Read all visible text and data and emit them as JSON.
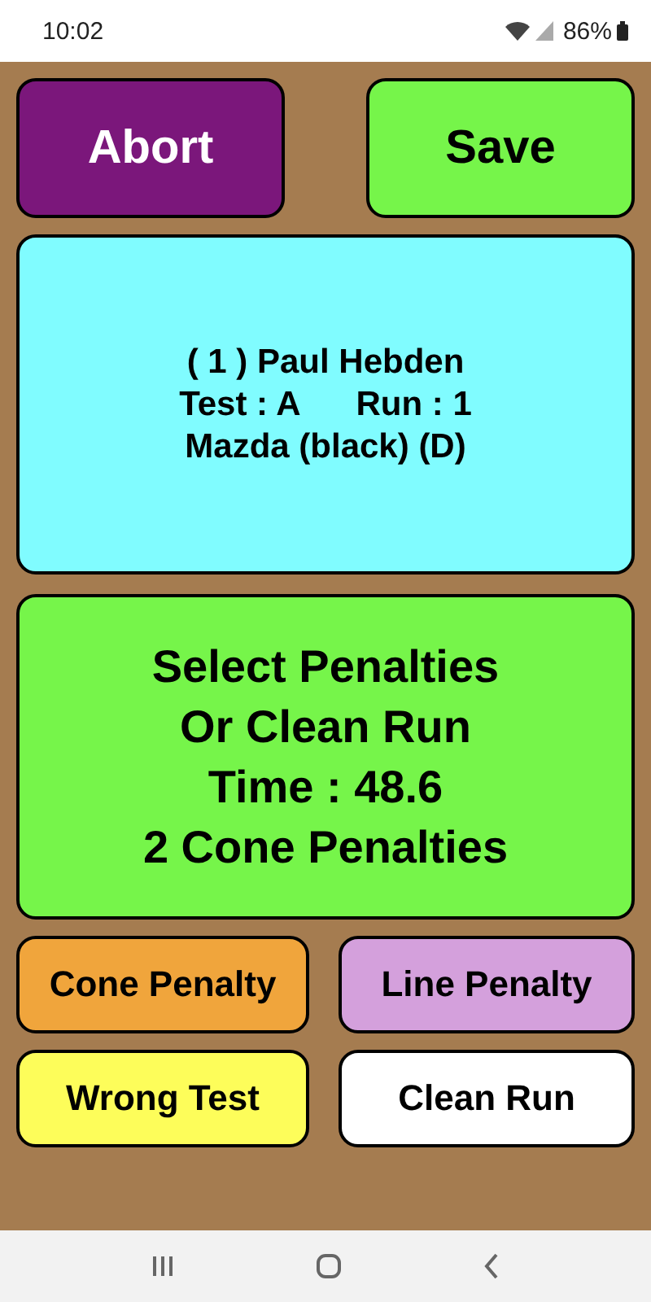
{
  "status_bar": {
    "time": "10:02",
    "battery": "86%"
  },
  "top_buttons": [
    {
      "label": "Abort",
      "color": "#7b177b"
    },
    {
      "label": "Save",
      "color": "#76f54a"
    }
  ],
  "driver_card": {
    "title": "( 1 ) Paul Hebden",
    "test": "Test : A",
    "run": "Run : 1",
    "car": "Mazda (black) (D)"
  },
  "status_panel": {
    "lines": [
      "Select Penalties",
      "Or Clean Run",
      "Time : 48.6",
      "2 Cone Penalties"
    ]
  },
  "action_buttons": [
    {
      "label": "Cone Penalty",
      "color": "#f0a53c"
    },
    {
      "label": "Line Penalty",
      "color": "#d4a0dc"
    },
    {
      "label": "Wrong Test",
      "color": "#fdfd5a"
    },
    {
      "label": "Clean Run",
      "color": "#ffffff"
    }
  ]
}
